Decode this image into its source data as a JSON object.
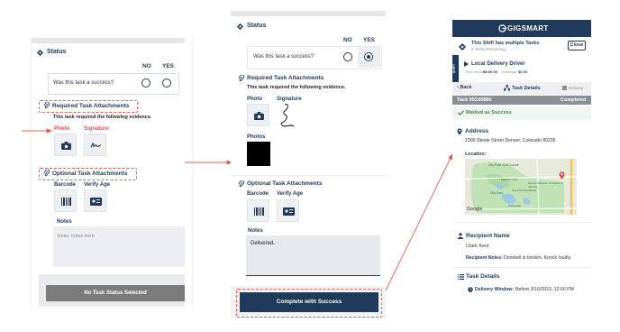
{
  "screen1": {
    "status_title": "Status",
    "no_label": "NO",
    "yes_label": "YES",
    "question": "Was this task a success?",
    "required_title": "Required Task Attachments",
    "required_desc": "This task required the following evidence.",
    "photo_label": "Photo",
    "signature_label": "Signature",
    "optional_title": "Optional Task Attachments",
    "barcode_label": "Barcode",
    "verify_age_label": "Verify Age",
    "notes_label": "Notes",
    "notes_placeholder": "Enter notes here",
    "button_label": "No Task Status Selected"
  },
  "screen2": {
    "status_title": "Status",
    "no_label": "NO",
    "yes_label": "YES",
    "question": "Was this task a success?",
    "required_title": "Required Task Attachments",
    "required_desc": "This task required the following evidence.",
    "photo_label": "Photo",
    "signature_label": "Signature",
    "photos_label": "Photos",
    "optional_title": "Optional Task Attachments",
    "barcode_label": "Barcode",
    "verify_age_label": "Verify Age",
    "notes_label": "Notes",
    "notes_value": "Delivered.",
    "button_label": "Complete with Success",
    "selected_answer": "YES"
  },
  "screen3": {
    "brand": "GIGSMART",
    "shift_tag": "SHIFT",
    "multi_title": "This Shift has multiple Tasks",
    "multi_sub": "2 Tasks Remaining",
    "close_label": "Close",
    "job_title": "Local Delivery Driver",
    "time_worked_label": "Time Worked:",
    "time_worked_value": "00:00:00",
    "earnings_label": "Earnings:",
    "earnings_value": "$0.00",
    "back_label": "Back",
    "task_details_label": "Task Details",
    "delivery_label": "Delivery",
    "task_id": "Task 952d088b",
    "task_status": "Completed",
    "marked_success": "Marked as Success",
    "address_title": "Address",
    "address_value": "2300 Steele Street  Denver, Colorado 80205",
    "location_label": "Location:",
    "map_labels": {
      "golf": "City Park Golf Course",
      "zoo": "Denver Zoo",
      "museum": "Denver Museum of Nature & Science",
      "esplanade": "City Park Esplanade",
      "park": "City Park",
      "ferril": "Ferril Lake",
      "google": "Google"
    },
    "recipient_title": "Recipient Name",
    "recipient_name": "Clark Kent",
    "recipient_notes_label": "Recipient Notes:",
    "recipient_notes_value": "Doorbell is broken. Knock loudly.",
    "task_details_title": "Task Details",
    "delivery_window_label": "Delivery Window:",
    "delivery_window_value": "Before 3/10/2023, 12:00 PM"
  },
  "colors": {
    "navy": "#1f3a5a",
    "annotation_red": "#e06155",
    "disabled_button": "#7b7b7b",
    "success_green": "#3b8a4d",
    "task_bar": "#8a8f95"
  }
}
